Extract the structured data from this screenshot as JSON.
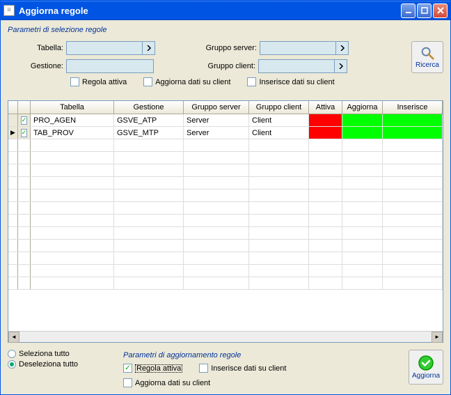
{
  "window": {
    "title": "Aggiorna regole"
  },
  "filters": {
    "section_title": "Parametri di selezione regole",
    "tabella_label": "Tabella:",
    "gestione_label": "Gestione:",
    "gruppo_server_label": "Gruppo server:",
    "gruppo_client_label": "Gruppo client:",
    "tabella_value": "",
    "gestione_value": "",
    "gruppo_server_value": "",
    "gruppo_client_value": "",
    "chk_regola_attiva": "Regola attiva",
    "chk_aggiorna_dati": "Aggiorna dati su client",
    "chk_inserisce_dati": "Inserisce dati su client",
    "search_label": "Ricerca"
  },
  "grid": {
    "headers": {
      "tabella": "Tabella",
      "gestione": "Gestione",
      "gruppo_server": "Gruppo server",
      "gruppo_client": "Gruppo client",
      "attiva": "Attiva",
      "aggiorna": "Aggiorna",
      "inserisce": "Inserisce"
    },
    "rows": [
      {
        "checked": true,
        "current": false,
        "tabella": "PRO_AGEN",
        "gestione": "GSVE_ATP",
        "gruppo_server": "Server",
        "gruppo_client": "Client",
        "attiva": "red",
        "aggiorna": "green",
        "inserisce": "green"
      },
      {
        "checked": true,
        "current": true,
        "tabella": "TAB_PROV",
        "gestione": "GSVE_MTP",
        "gruppo_server": "Server",
        "gruppo_client": "Client",
        "attiva": "red",
        "aggiorna": "green",
        "inserisce": "green"
      }
    ]
  },
  "selection": {
    "select_all": "Seleziona tutto",
    "deselect_all": "Deseleziona tutto",
    "selected": "deselect_all"
  },
  "update_params": {
    "section_title": "Parametri di aggiornamento regole",
    "chk_regola_attiva": "Regola attiva",
    "chk_inserisce_dati": "Inserisce dati su client",
    "chk_aggiorna_dati": "Aggiorna dati su client",
    "regola_attiva_checked": true,
    "inserisce_checked": false,
    "aggiorna_checked": false,
    "apply_label": "Aggiorna"
  }
}
